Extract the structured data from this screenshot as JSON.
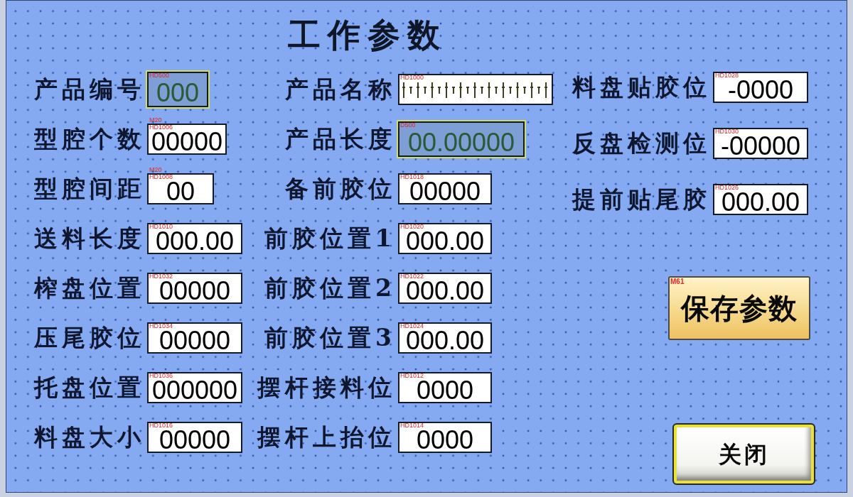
{
  "title": "工作参数",
  "columns": [
    {
      "fields": [
        {
          "label": "产品编号",
          "tags": [
            "HD500"
          ],
          "value": "000",
          "kind": "number",
          "selected": true
        },
        {
          "label": "型腔个数",
          "tags": [
            "M20",
            "HD1006"
          ],
          "value": "00000",
          "kind": "number",
          "selected": false
        },
        {
          "label": "型腔间距",
          "tags": [
            "M20",
            "HD1008"
          ],
          "value": "00",
          "kind": "number",
          "selected": false
        },
        {
          "label": "送料长度",
          "tags": [
            "HD1010"
          ],
          "value": "000.00",
          "kind": "number",
          "selected": false
        },
        {
          "label": "榨盘位置",
          "tags": [
            "HD1032"
          ],
          "value": "00000",
          "kind": "number",
          "selected": false
        },
        {
          "label": "压尾胶位",
          "tags": [
            "HD1034"
          ],
          "value": "00000",
          "kind": "number",
          "selected": false
        },
        {
          "label": "托盘位置",
          "tags": [
            "HD1036"
          ],
          "value": "000000",
          "kind": "number",
          "selected": false
        },
        {
          "label": "料盘大小",
          "tags": [
            "HD1016"
          ],
          "value": "00000",
          "kind": "number",
          "selected": false
        }
      ]
    },
    {
      "fields": [
        {
          "label": "产品名称",
          "tags": [
            "HD1000"
          ],
          "kind": "text",
          "selected": false
        },
        {
          "label": "产品长度",
          "tags": [
            "D500"
          ],
          "value": "00.00000",
          "kind": "number",
          "selected": true
        },
        {
          "label": "备前胶位",
          "tags": [
            "HD1018"
          ],
          "value": "00000",
          "kind": "number",
          "selected": false
        },
        {
          "label": "前胶位置1",
          "tags": [
            "HD1020"
          ],
          "value": "000.00",
          "kind": "number",
          "selected": false
        },
        {
          "label": "前胶位置2",
          "tags": [
            "HD1022"
          ],
          "value": "000.00",
          "kind": "number",
          "selected": false
        },
        {
          "label": "前胶位置3",
          "tags": [
            "HD1024"
          ],
          "value": "000.00",
          "kind": "number",
          "selected": false
        },
        {
          "label": "摆杆接料位",
          "tags": [
            "HD1012"
          ],
          "value": "0000",
          "kind": "number",
          "selected": false
        },
        {
          "label": "摆杆上抬位",
          "tags": [
            "HD1014"
          ],
          "value": "0000",
          "kind": "number",
          "selected": false
        }
      ]
    },
    {
      "fields": [
        {
          "label": "料盘贴胶位",
          "tags": [
            "HD1028"
          ],
          "value": "-0000",
          "kind": "number",
          "selected": false
        },
        {
          "label": "反盘检测位",
          "tags": [
            "HD1030"
          ],
          "value": "-00000",
          "kind": "number",
          "selected": false
        },
        {
          "label": "提前贴尾胶",
          "tags": [
            "HD1026"
          ],
          "value": "000.00",
          "kind": "number",
          "selected": false
        }
      ]
    }
  ],
  "buttons": [
    {
      "label": "保存参数",
      "tag": "M61",
      "kind": "save"
    },
    {
      "label": "关闭",
      "kind": "close"
    }
  ]
}
